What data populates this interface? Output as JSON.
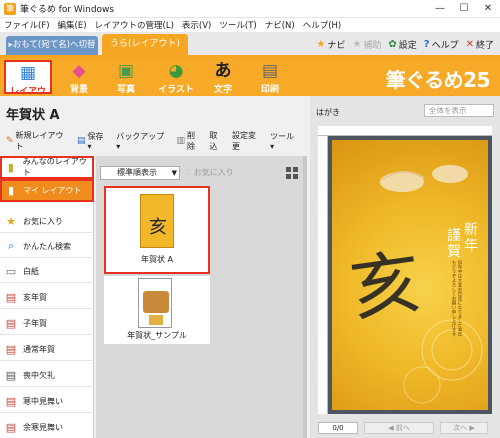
{
  "window": {
    "title": "筆ぐるめ for Windows",
    "app_icon": "筆",
    "controls": [
      "—",
      "☐",
      "✕"
    ]
  },
  "menu": [
    "ファイル(F)",
    "編集(E)",
    "レイアウトの管理(L)",
    "表示(V)",
    "ツール(T)",
    "ナビ(N)",
    "ヘルプ(H)"
  ],
  "tabs": {
    "switch_label": "▸おもて(宛て名)へ切替",
    "active_label": "うら(レイアウト)"
  },
  "top_links": [
    {
      "icon": "★",
      "label": "ナビ",
      "color": "#f5a623"
    },
    {
      "icon": "★",
      "label": "補助",
      "color": "#bbbbbb"
    },
    {
      "icon": "✿",
      "label": "設定",
      "color": "#2d8a3e"
    },
    {
      "icon": "?",
      "label": "ヘルプ",
      "color": "#2d6ccf"
    },
    {
      "icon": "✕",
      "label": "終了",
      "color": "#d03a2a"
    }
  ],
  "toolbar": {
    "buttons": [
      {
        "icon": "▦",
        "label": "レイアウト"
      },
      {
        "icon": "◆",
        "label": "背景"
      },
      {
        "icon": "▣",
        "label": "写真"
      },
      {
        "icon": "◕",
        "label": "イラスト"
      },
      {
        "icon": "あ",
        "label": "文字"
      },
      {
        "icon": "▤",
        "label": "印刷"
      }
    ],
    "brand": "筆ぐるめ25",
    "accent_color": "#f7a928",
    "selected_border": "#e8321f"
  },
  "panel": {
    "title": "年賀状 A"
  },
  "commands": [
    {
      "icon": "✎",
      "label": "新規レイアウト"
    },
    {
      "icon": "▤",
      "label": "保存 ▾"
    },
    {
      "icon": "",
      "label": "バックアップ ▾"
    },
    {
      "icon": "▥",
      "label": "削除"
    },
    {
      "icon": "",
      "label": "取込"
    },
    {
      "icon": "",
      "label": "設定変更"
    },
    {
      "icon": "",
      "label": "ツール ▾"
    }
  ],
  "sidebar": {
    "items": [
      {
        "icon": "▮",
        "label": "みんなのレイアウト"
      },
      {
        "icon": "▮",
        "label": "マイ レイアウト"
      },
      {
        "icon": "★",
        "label": "お気に入り"
      },
      {
        "icon": "⌕",
        "label": "かんたん検索"
      },
      {
        "icon": "▭",
        "label": "白紙"
      },
      {
        "icon": "▤",
        "label": "亥年賀"
      },
      {
        "icon": "▤",
        "label": "子年賀"
      },
      {
        "icon": "▤",
        "label": "通常年賀"
      },
      {
        "icon": "▤",
        "label": "喪中欠礼"
      },
      {
        "icon": "▤",
        "label": "寒中見舞い"
      },
      {
        "icon": "▤",
        "label": "余寒見舞い"
      }
    ]
  },
  "list": {
    "sort_label": "標準順表示",
    "favorite_label": "お気に入り",
    "cards": [
      {
        "label": "年賀状 A"
      },
      {
        "label": "年賀状_サンプル"
      }
    ]
  },
  "preview": {
    "paper_label": "はがき",
    "zoom_label": "全体を表示",
    "card_text_col1": "謹賀",
    "card_text_col2": "新年",
    "card_kanji": "亥",
    "card_small_text": "旧年中は大変お世話になりました本年もどうぞよろしくお願い申し上げます",
    "page_count": "0/0",
    "prev_label": "◀ 前へ",
    "next_label": "次へ ▶"
  }
}
